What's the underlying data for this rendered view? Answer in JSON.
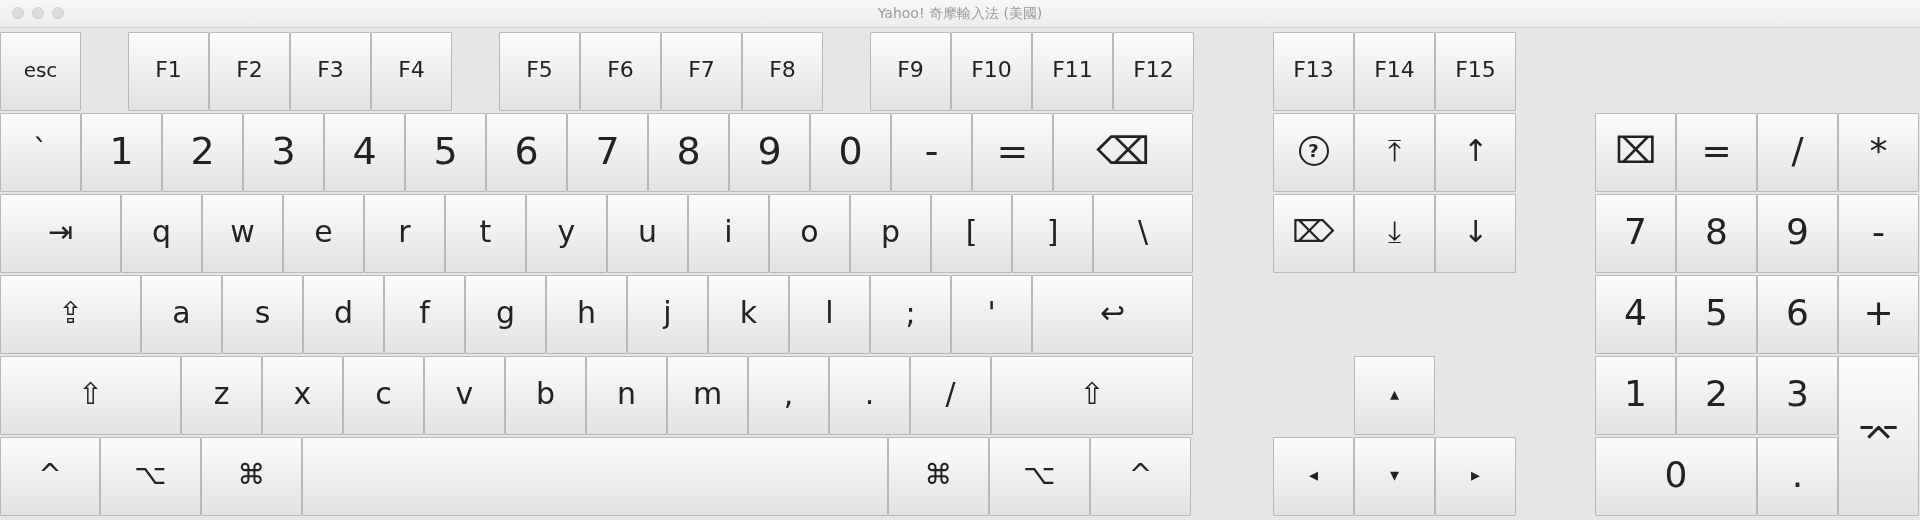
{
  "window": {
    "title": "Yahoo! 奇摩輸入法 (美國)"
  },
  "function_row": [
    [
      {
        "kind": "key",
        "label": "esc"
      }
    ],
    [
      {
        "kind": "key",
        "label": "F1"
      },
      {
        "kind": "key",
        "label": "F2"
      },
      {
        "kind": "key",
        "label": "F3"
      },
      {
        "kind": "key",
        "label": "F4"
      }
    ],
    [
      {
        "kind": "key",
        "label": "F5"
      },
      {
        "kind": "key",
        "label": "F6"
      },
      {
        "kind": "key",
        "label": "F7"
      },
      {
        "kind": "key",
        "label": "F8"
      }
    ],
    [
      {
        "kind": "key",
        "label": "F9"
      },
      {
        "kind": "key",
        "label": "F10"
      },
      {
        "kind": "key",
        "label": "F11"
      },
      {
        "kind": "key",
        "label": "F12"
      }
    ]
  ],
  "main_rows": [
    [
      {
        "kind": "key",
        "label": "`"
      },
      {
        "kind": "key",
        "label": "1"
      },
      {
        "kind": "key",
        "label": "2"
      },
      {
        "kind": "key",
        "label": "3"
      },
      {
        "kind": "key",
        "label": "4"
      },
      {
        "kind": "key",
        "label": "5"
      },
      {
        "kind": "key",
        "label": "6"
      },
      {
        "kind": "key",
        "label": "7"
      },
      {
        "kind": "key",
        "label": "8"
      },
      {
        "kind": "key",
        "label": "9"
      },
      {
        "kind": "key",
        "label": "0"
      },
      {
        "kind": "key",
        "label": "-"
      },
      {
        "kind": "key",
        "label": "="
      },
      {
        "kind": "key",
        "label": "⌫"
      }
    ],
    [
      {
        "kind": "key",
        "label": "⇥"
      },
      {
        "kind": "key",
        "label": "q"
      },
      {
        "kind": "key",
        "label": "w"
      },
      {
        "kind": "key",
        "label": "e"
      },
      {
        "kind": "key",
        "label": "r"
      },
      {
        "kind": "key",
        "label": "t"
      },
      {
        "kind": "key",
        "label": "y"
      },
      {
        "kind": "key",
        "label": "u"
      },
      {
        "kind": "key",
        "label": "i"
      },
      {
        "kind": "key",
        "label": "o"
      },
      {
        "kind": "key",
        "label": "p"
      },
      {
        "kind": "key",
        "label": "["
      },
      {
        "kind": "key",
        "label": "]"
      },
      {
        "kind": "key",
        "label": "\\"
      }
    ],
    [
      {
        "kind": "key",
        "label": "⇪"
      },
      {
        "kind": "key",
        "label": "a"
      },
      {
        "kind": "key",
        "label": "s"
      },
      {
        "kind": "key",
        "label": "d"
      },
      {
        "kind": "key",
        "label": "f"
      },
      {
        "kind": "key",
        "label": "g"
      },
      {
        "kind": "key",
        "label": "h"
      },
      {
        "kind": "key",
        "label": "j"
      },
      {
        "kind": "key",
        "label": "k"
      },
      {
        "kind": "key",
        "label": "l"
      },
      {
        "kind": "key",
        "label": ";"
      },
      {
        "kind": "key",
        "label": "'"
      },
      {
        "kind": "key",
        "label": "↩"
      }
    ],
    [
      {
        "kind": "key",
        "label": "⇧"
      },
      {
        "kind": "key",
        "label": "z"
      },
      {
        "kind": "key",
        "label": "x"
      },
      {
        "kind": "key",
        "label": "c"
      },
      {
        "kind": "key",
        "label": "v"
      },
      {
        "kind": "key",
        "label": "b"
      },
      {
        "kind": "key",
        "label": "n"
      },
      {
        "kind": "key",
        "label": "m"
      },
      {
        "kind": "key",
        "label": ","
      },
      {
        "kind": "key",
        "label": "."
      },
      {
        "kind": "key",
        "label": "/"
      },
      {
        "kind": "key",
        "label": "⇧"
      }
    ],
    [
      {
        "kind": "key",
        "label": "^"
      },
      {
        "kind": "key",
        "label": "⌥"
      },
      {
        "kind": "key",
        "label": "⌘"
      },
      {
        "kind": "space"
      },
      {
        "kind": "key",
        "label": "⌘"
      },
      {
        "kind": "key",
        "label": "⌥"
      },
      {
        "kind": "key",
        "label": "^"
      }
    ]
  ],
  "navigation_rows": [
    [
      {
        "kind": "key",
        "label": "F13"
      },
      {
        "kind": "key",
        "label": "F14"
      },
      {
        "kind": "key",
        "label": "F15"
      }
    ],
    [
      {
        "kind": "circled",
        "label": "?"
      },
      {
        "kind": "key",
        "label": "⤒"
      },
      {
        "kind": "key",
        "label": "↑"
      }
    ],
    [
      {
        "kind": "key",
        "label": "⌦"
      },
      {
        "kind": "key",
        "label": "⤓"
      },
      {
        "kind": "key",
        "label": "↓"
      }
    ]
  ],
  "arrow_keys": [
    {
      "kind": "key",
      "label": "▴"
    },
    {
      "kind": "key",
      "label": "◂"
    },
    {
      "kind": "key",
      "label": "▾"
    },
    {
      "kind": "key",
      "label": "▸"
    }
  ],
  "keypad": [
    {
      "kind": "key",
      "label": "⌧"
    },
    {
      "kind": "key",
      "label": "="
    },
    {
      "kind": "key",
      "label": "/"
    },
    {
      "kind": "key",
      "label": "*"
    },
    {
      "kind": "key",
      "label": "7"
    },
    {
      "kind": "key",
      "label": "8"
    },
    {
      "kind": "key",
      "label": "9"
    },
    {
      "kind": "key",
      "label": "-"
    },
    {
      "kind": "key",
      "label": "4"
    },
    {
      "kind": "key",
      "label": "5"
    },
    {
      "kind": "key",
      "label": "6"
    },
    {
      "kind": "key",
      "label": "+"
    },
    {
      "kind": "key",
      "label": "1"
    },
    {
      "kind": "key",
      "label": "2"
    },
    {
      "kind": "key",
      "label": "3"
    },
    {
      "kind": "key",
      "label": "⌤"
    },
    {
      "kind": "key",
      "label": "0"
    },
    {
      "kind": "key",
      "label": "."
    }
  ]
}
